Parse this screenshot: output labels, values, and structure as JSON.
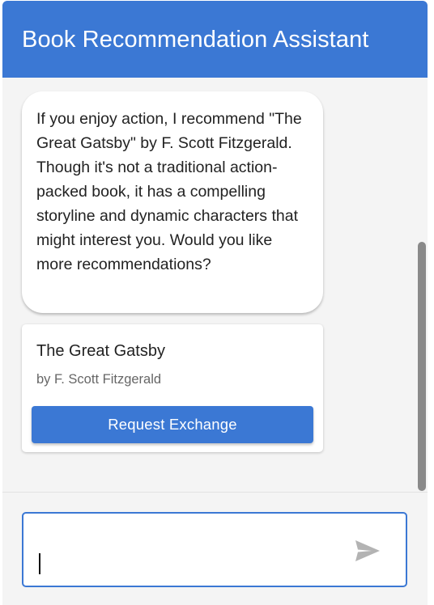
{
  "header": {
    "title": "Book Recommendation Assistant"
  },
  "chat": {
    "messages": [
      {
        "role": "assistant",
        "text": "If you enjoy action, I recommend \"The Great Gatsby\" by F. Scott Fitzgerald. Though it's not a traditional action-packed book, it has a compelling storyline and dynamic characters that might interest you. Would you like more recommendations?"
      }
    ],
    "book_card": {
      "title": "The Great Gatsby",
      "author": "by F. Scott Fitzgerald",
      "button_label": "Request Exchange"
    }
  },
  "composer": {
    "value": "",
    "placeholder": "",
    "send_icon": "send-icon"
  },
  "colors": {
    "accent": "#3b78d4",
    "chat_background": "#f4f4f4",
    "bubble_background": "#ffffff",
    "send_icon": "#b3b3b3",
    "scrollbar_thumb": "#8a8a8a"
  }
}
